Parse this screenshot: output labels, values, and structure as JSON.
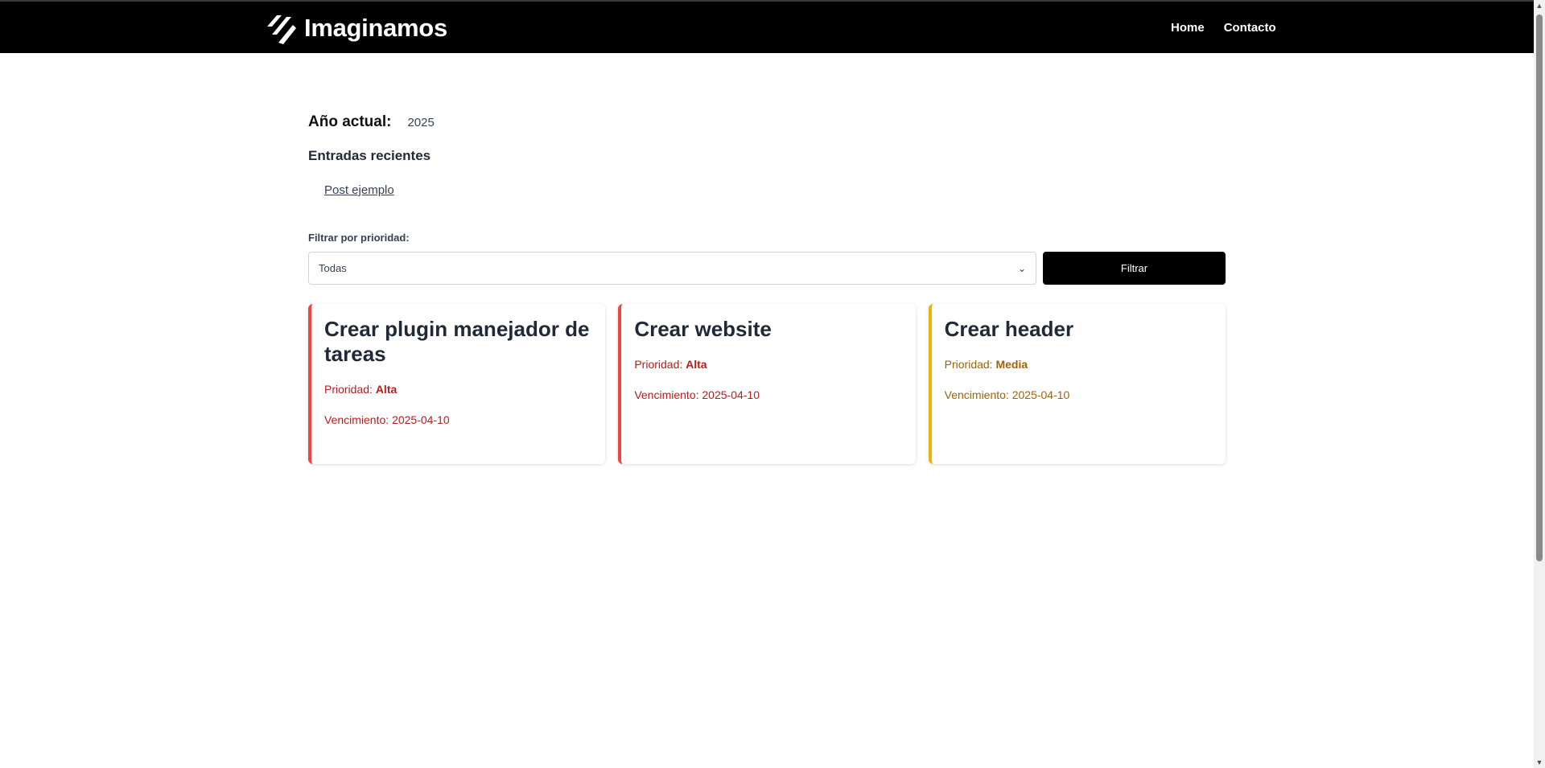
{
  "header": {
    "brand": "Imaginamos",
    "nav": [
      {
        "label": "Home"
      },
      {
        "label": "Contacto"
      }
    ]
  },
  "main": {
    "year_label": "Año actual:",
    "year_value": "2025",
    "recent_title": "Entradas recientes",
    "recent_posts": [
      {
        "label": "Post ejemplo"
      }
    ],
    "filter_label": "Filtrar por prioridad:",
    "filter_selected": "Todas",
    "filter_button": "Filtrar"
  },
  "tasks": [
    {
      "title": "Crear plugin manejador de tareas",
      "priority_label": "Prioridad:",
      "priority": "Alta",
      "due_label": "Vencimiento:",
      "due": "2025-04-10",
      "color": "#ef4444"
    },
    {
      "title": "Crear website",
      "priority_label": "Prioridad:",
      "priority": "Alta",
      "due_label": "Vencimiento:",
      "due": "2025-04-10",
      "color": "#ef4444"
    },
    {
      "title": "Crear header",
      "priority_label": "Prioridad:",
      "priority": "Media",
      "due_label": "Vencimiento:",
      "due": "2025-04-10",
      "color": "#eab308"
    }
  ],
  "icons": {
    "brand_logo": "imaginamos-logo-icon",
    "select_chevron": "chevron-down-icon"
  }
}
